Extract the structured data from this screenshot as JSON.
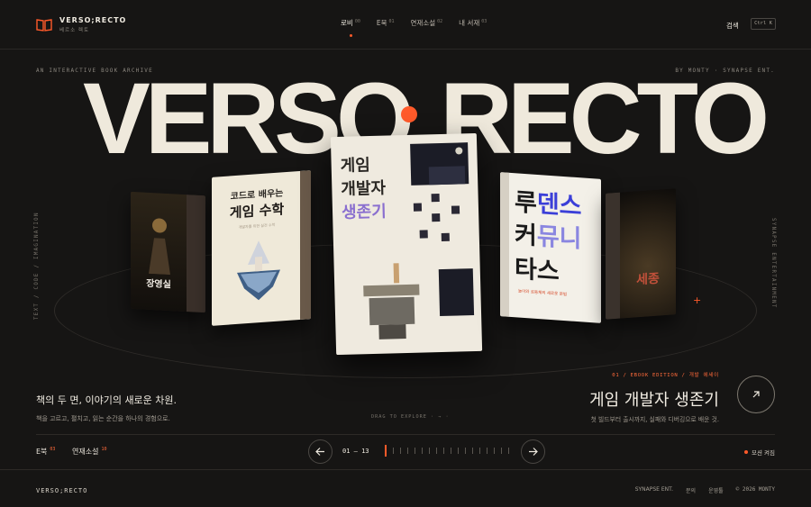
{
  "brand": {
    "title": "VERSO;RECTO",
    "subtitle": "베르소 렉토"
  },
  "nav": [
    {
      "label": "로비",
      "num": "00"
    },
    {
      "label": "E북",
      "num": "01"
    },
    {
      "label": "연재소설",
      "num": "02"
    },
    {
      "label": "내 서재",
      "num": "03"
    }
  ],
  "search_label": "검색",
  "shortcut": "Ctrl K",
  "top_left": "AN INTERACTIVE BOOK ARCHIVE",
  "top_right": "BY MONTY · SYNAPSE ENT.",
  "side_left": "TEXT / CODE / IMAGINATION",
  "side_right": "SYNAPSE ENTERTAINMENT",
  "hero": {
    "left": "VERSO",
    "right": "RECTO"
  },
  "books": [
    {
      "title": "장영실"
    },
    {
      "title": "코드로 배우는 게임 수학",
      "line1": "코드로 배우는",
      "line2": "게임 수학",
      "sub": "개발자를 위한 실전 수학"
    },
    {
      "title": "게임 개발자 생존기",
      "line1": "게임",
      "line2": "개발자",
      "line3": "생존기"
    },
    {
      "title": "루덴스 커뮤니타스",
      "l1a": "루",
      "l1b": "덴스",
      "l2a": "커",
      "l2b": "뮤니",
      "l3": "타스",
      "sub": "놀이와 공동체의 새로운 문법"
    },
    {
      "title": "세종"
    }
  ],
  "tagline": "책의 두 면, 이야기의 새로운 차원.",
  "subline": "책을 고르고, 펼치고, 읽는 순간을 하나의 경험으로.",
  "drag_hint": "DRAG TO EXPLORE · → ·",
  "featured": {
    "meta": "01 / EBOOK EDITION / 개발 에세이",
    "title": "게임 개발자 생존기",
    "desc": "첫 빌드부터 출시까지, 실패와 디버깅으로 배운 것."
  },
  "categories": [
    {
      "label": "E북",
      "count": "03"
    },
    {
      "label": "연재소설",
      "count": "10"
    }
  ],
  "pager": {
    "current": "01",
    "total": "13"
  },
  "motion_label": "모션 켜짐",
  "footer": {
    "brand": "VERSO;RECTO",
    "links": [
      "SYNAPSE ENT.",
      "문의",
      "운영툴"
    ],
    "copyright": "© 2026 MONTY"
  },
  "colors": {
    "accent": "#ff5a2a",
    "background": "#161514",
    "text": "#efe9dc"
  }
}
